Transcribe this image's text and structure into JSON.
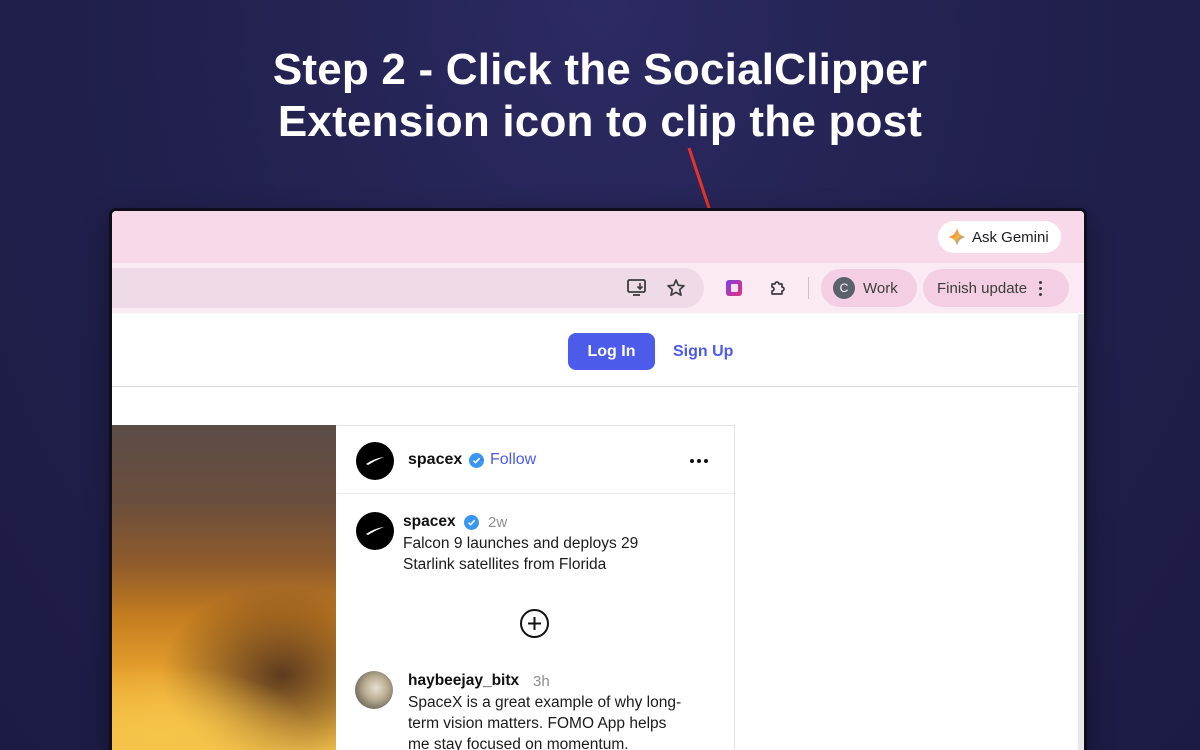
{
  "headline": {
    "line1": "Step 2 - Click the SocialClipper",
    "line2": "Extension icon to clip the post"
  },
  "colors": {
    "background": "#22214f",
    "arrow": "#e8332a",
    "chrome_tab_strip": "#f7d9ea",
    "brand_blue": "#4c5bea",
    "verified_blue": "#3897f0"
  },
  "browser": {
    "gemini": {
      "label": "Ask Gemini",
      "icon": "gemini-sparkle-icon"
    },
    "toolbar": {
      "install_icon": "install-app-icon",
      "bookmark_icon": "star-icon",
      "socialclipper_icon": "socialclipper-extension-icon",
      "extensions_icon": "puzzle-piece-icon",
      "profile": {
        "initial": "C",
        "label": "Work"
      },
      "update": {
        "label": "Finish update",
        "icon": "more-vertical-icon"
      }
    }
  },
  "site": {
    "login_label": "Log In",
    "signup_label": "Sign Up"
  },
  "post": {
    "author": "spacex",
    "follow_label": "Follow",
    "separator": "·",
    "caption": {
      "author": "spacex",
      "time": "2w",
      "line1": "Falcon 9 launches and deploys 29",
      "line2": "Starlink satellites from Florida"
    },
    "comment": {
      "author": "haybeejay_bitx",
      "time": "3h",
      "line1": "SpaceX is a great example of why long-",
      "line2": "term vision matters. FOMO App helps",
      "line3": "me stay focused on momentum."
    }
  }
}
